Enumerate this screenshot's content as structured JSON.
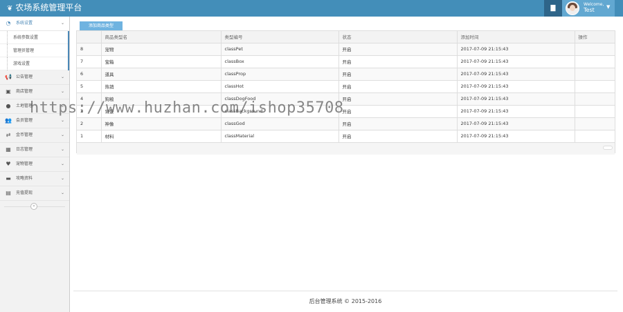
{
  "header": {
    "title": "农场系统管理平台",
    "welcome": "Welcome,",
    "username": "Test"
  },
  "sidebar": {
    "items": [
      {
        "icon": "tachometer-icon",
        "label": "系统设置",
        "open": true,
        "children": [
          "系统参数设置",
          "管理员管理",
          "游戏设置"
        ]
      },
      {
        "icon": "bullhorn-icon",
        "label": "公告管理"
      },
      {
        "icon": "gift-icon",
        "label": "商店管理"
      },
      {
        "icon": "globe-icon",
        "label": "土地管理"
      },
      {
        "icon": "users-icon",
        "label": "会员管理"
      },
      {
        "icon": "exchange-icon",
        "label": "金币管理"
      },
      {
        "icon": "calendar-icon",
        "label": "日志管理"
      },
      {
        "icon": "heart-icon",
        "label": "宠物管理"
      },
      {
        "icon": "folder-icon",
        "label": "攻略资料"
      },
      {
        "icon": "list-alt-icon",
        "label": "充值提现"
      }
    ]
  },
  "toolbar": {
    "add_label": "添加商品类型"
  },
  "table": {
    "columns": [
      "",
      "商品类型名",
      "类型编号",
      "状态",
      "添加时间",
      "操作"
    ],
    "rows": [
      [
        "8",
        "宠物",
        "classPet",
        "开启",
        "2017-07-09 21:15:43",
        ""
      ],
      [
        "7",
        "宝箱",
        "classBox",
        "开启",
        "2017-07-09 21:15:43",
        ""
      ],
      [
        "6",
        "道具",
        "classProp",
        "开启",
        "2017-07-09 21:15:43",
        ""
      ],
      [
        "5",
        "热销",
        "classHot",
        "开启",
        "2017-07-09 21:15:43",
        ""
      ],
      [
        "4",
        "狗粮",
        "classDogFood",
        "开启",
        "2017-07-09 21:15:43",
        ""
      ],
      [
        "3",
        "背景",
        "classBackground",
        "开启",
        "2017-07-09 21:15:43",
        ""
      ],
      [
        "2",
        "神像",
        "classGod",
        "开启",
        "2017-07-09 21:15:43",
        ""
      ],
      [
        "1",
        "材料",
        "classMaterial",
        "开启",
        "2017-07-09 21:15:43",
        ""
      ]
    ]
  },
  "watermark": "https://www.huzhan.com/ishop35708",
  "footer": "后台管理系统 © 2015-2016",
  "colors": {
    "header": "#438eb9",
    "accent": "#6fb3e0",
    "user_bg": "#62a8d1"
  }
}
